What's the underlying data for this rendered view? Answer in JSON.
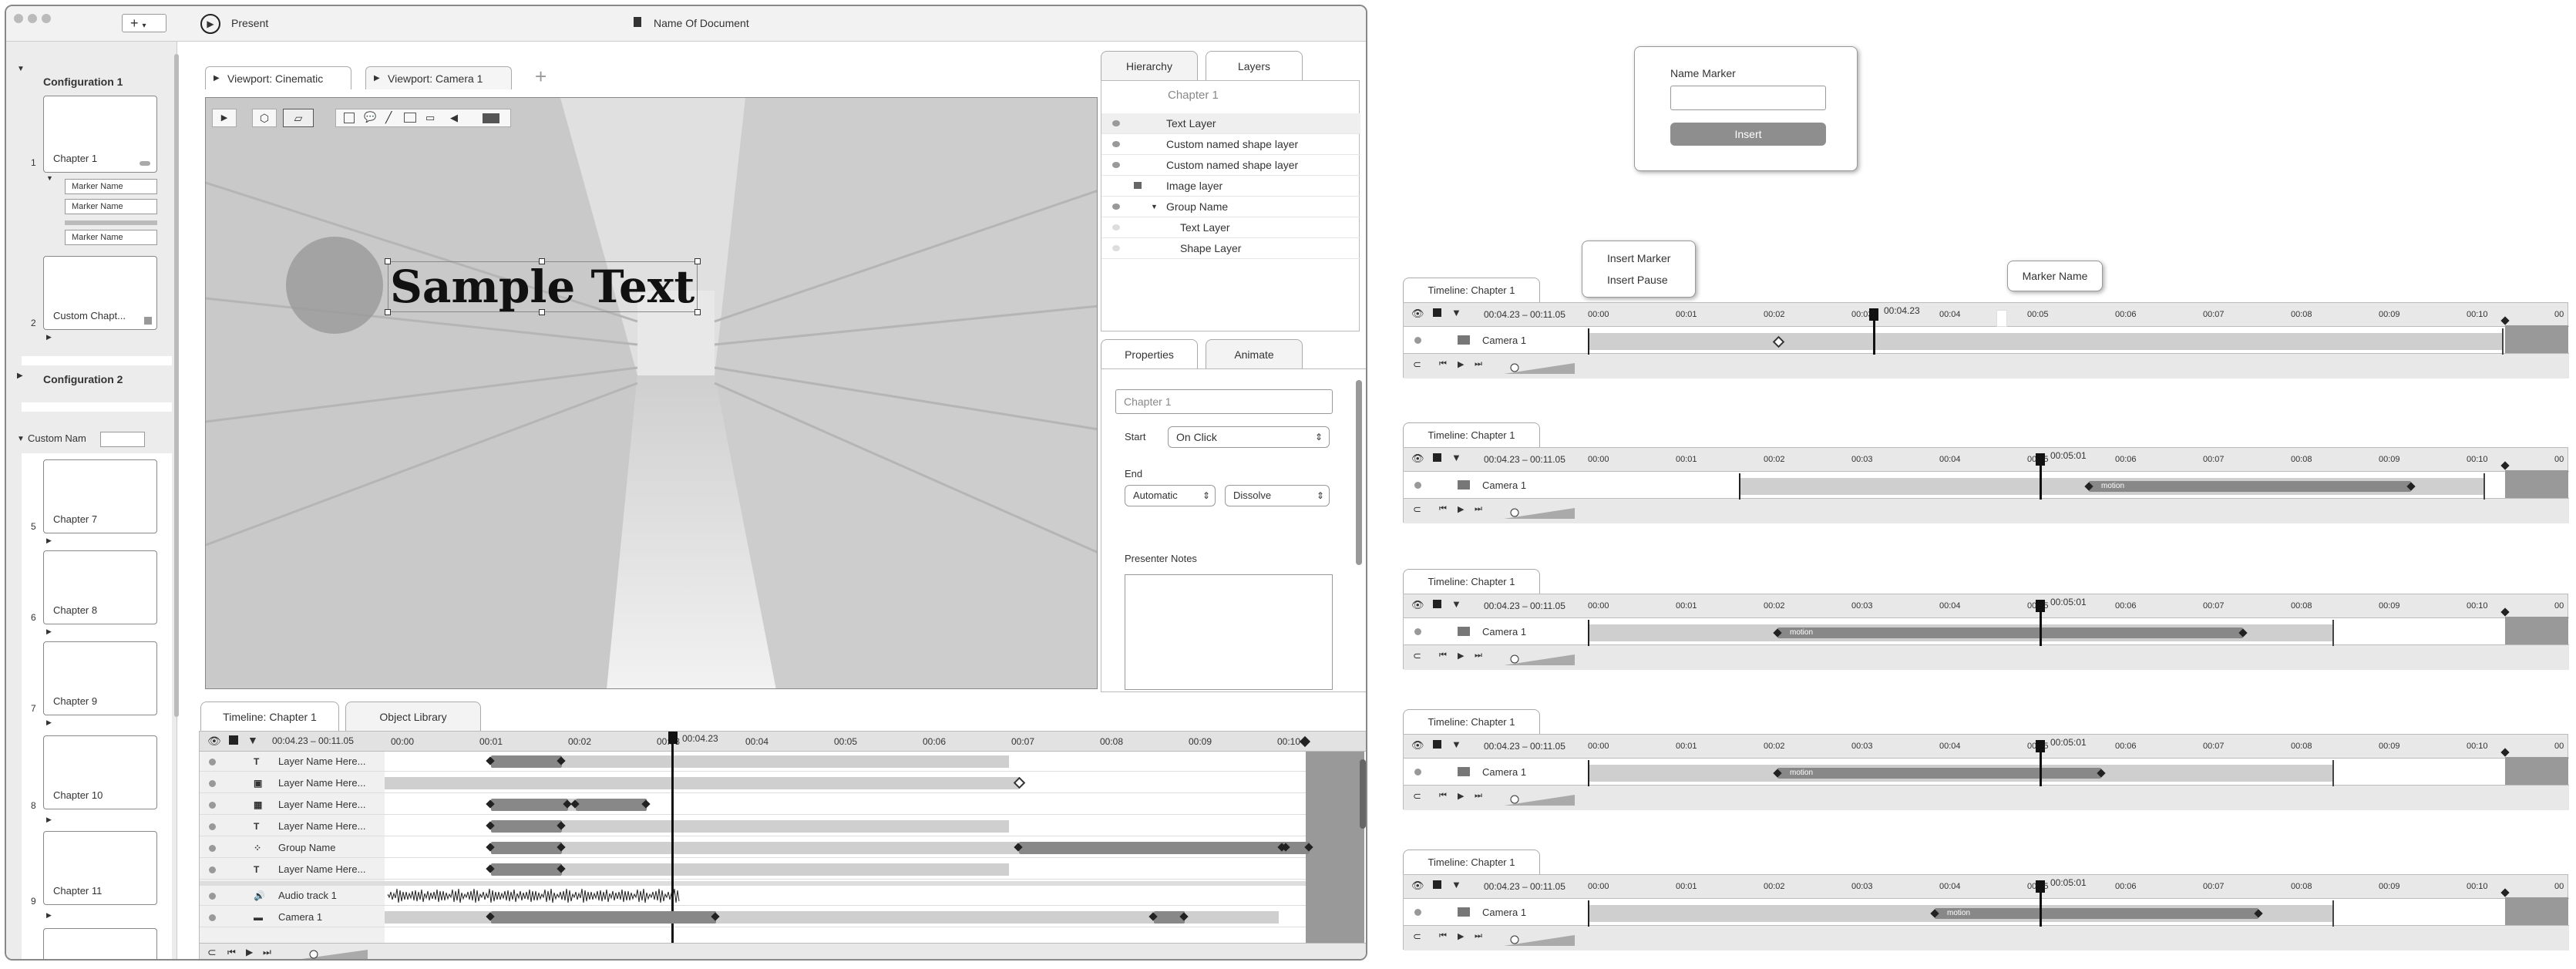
{
  "toolbar": {
    "add_label": "+",
    "present_label": "Present",
    "doc_title": "Name Of Document"
  },
  "sidebar": {
    "config1": "Configuration 1",
    "config2": "Configuration 2",
    "config3_value": "Custom Nam",
    "slides": [
      {
        "num": "1",
        "label": "Chapter 1"
      },
      {
        "num": "2",
        "label": "Custom Chapt..."
      },
      {
        "num": "5",
        "label": "Chapter 7"
      },
      {
        "num": "6",
        "label": "Chapter 8"
      },
      {
        "num": "7",
        "label": "Chapter 9"
      },
      {
        "num": "8",
        "label": "Chapter 10"
      },
      {
        "num": "9",
        "label": "Chapter 11"
      }
    ],
    "markers": [
      "Marker Name",
      "Marker Name",
      "Marker Name"
    ]
  },
  "viewport": {
    "tab1": "Viewport:  Cinematic",
    "tab2": "Viewport:  Camera 1",
    "add": "+",
    "sample_text": "Sample Text"
  },
  "layers": {
    "tab_hierarchy": "Hierarchy",
    "tab_layers": "Layers",
    "chapter": "Chapter 1",
    "items": [
      "Text Layer",
      "Custom named shape layer",
      "Custom named shape layer",
      "Image layer",
      "Group Name",
      "Text Layer",
      "Shape Layer"
    ]
  },
  "properties": {
    "tab_props": "Properties",
    "tab_anim": "Animate",
    "name_value": "Chapter 1",
    "start_label": "Start",
    "start_value": "On Click",
    "end_label": "End",
    "end_value1": "Automatic",
    "end_value2": "Dissolve",
    "notes_label": "Presenter Notes"
  },
  "main_timeline": {
    "tab1": "Timeline:  Chapter 1",
    "tab2": "Object Library",
    "range": "00:04.23 – 00:11.05",
    "playhead_label": "00:04.23",
    "ticks": [
      "00:00",
      "00:01",
      "00:02",
      "00:03",
      "00:04",
      "00:05",
      "00:06",
      "00:07",
      "00:08",
      "00:09",
      "00:10",
      "00"
    ],
    "rows": [
      "Layer Name Here...",
      "Layer Name Here...",
      "Layer Name Here...",
      "Layer Name Here...",
      "Group Name",
      "Layer Name Here...",
      "Audio track 1",
      "Camera 1"
    ]
  },
  "marker_dialog": {
    "label": "Name Marker",
    "input_value": "",
    "button": "Insert"
  },
  "insert_menu": {
    "item1": "Insert Marker",
    "item2": "Insert Pause"
  },
  "marker_bubble": "Marker Name",
  "mini_timelines": [
    {
      "tab": "Timeline:  Chapter 1",
      "range": "00:04.23 – 00:11.05",
      "playhead": "00:04.23",
      "row": "Camera 1",
      "motion": ""
    },
    {
      "tab": "Timeline:  Chapter 1",
      "range": "00:04.23 – 00:11.05",
      "playhead": "00:05:01",
      "row": "Camera 1",
      "motion": "motion"
    },
    {
      "tab": "Timeline:  Chapter 1",
      "range": "00:04.23 – 00:11.05",
      "playhead": "00:05:01",
      "row": "Camera 1",
      "motion": "motion"
    },
    {
      "tab": "Timeline:  Chapter 1",
      "range": "00:04.23 – 00:11.05",
      "playhead": "00:05:01",
      "row": "Camera 1",
      "motion": "motion"
    },
    {
      "tab": "Timeline:  Chapter 1",
      "range": "00:04.23 – 00:11.05",
      "playhead": "00:05:01",
      "row": "Camera 1",
      "motion": "motion"
    }
  ],
  "mini_ticks": [
    "00:00",
    "00:01",
    "00:02",
    "00:03",
    "00:04",
    "00:05",
    "00:06",
    "00:07",
    "00:08",
    "00:09",
    "00:10",
    "00"
  ]
}
